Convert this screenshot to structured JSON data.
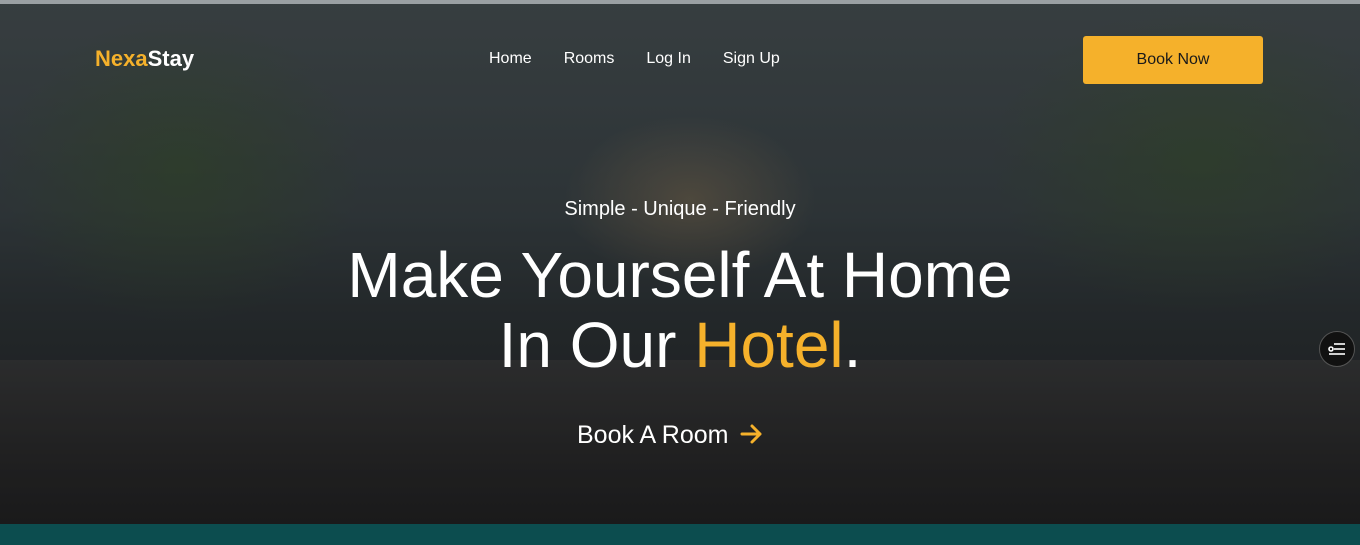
{
  "brand": {
    "part1": "Nexa",
    "part2": "Stay"
  },
  "nav": {
    "items": [
      {
        "label": "Home"
      },
      {
        "label": "Rooms"
      },
      {
        "label": "Log In"
      },
      {
        "label": "Sign Up"
      }
    ]
  },
  "header": {
    "cta_label": "Book Now"
  },
  "hero": {
    "tagline": "Simple - Unique - Friendly",
    "headline_line1": "Make Yourself At Home",
    "headline_line2_prefix": "In Our ",
    "headline_highlight": "Hotel",
    "headline_suffix": ".",
    "cta_label": "Book A Room",
    "cta_icon": "arrow-right-icon"
  },
  "widget": {
    "icon": "settings-sliders-icon"
  },
  "colors": {
    "accent": "#f5b12b",
    "footer": "#0c4d4f",
    "text": "#ffffff"
  }
}
